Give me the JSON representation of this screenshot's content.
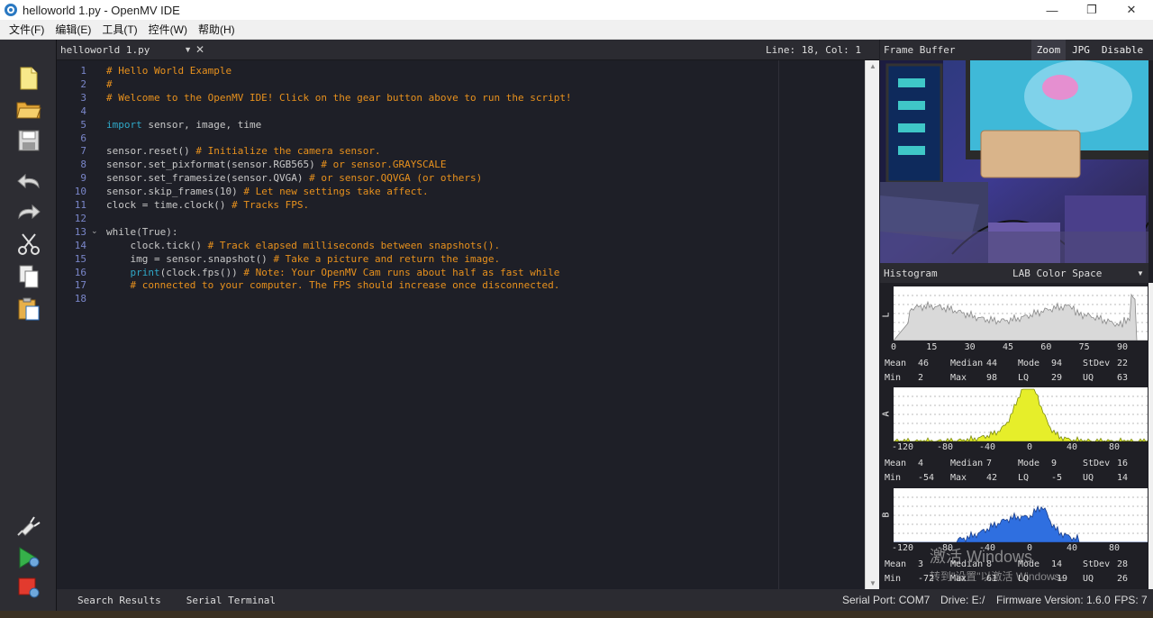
{
  "window": {
    "title": "helloworld 1.py - OpenMV IDE",
    "controls": {
      "minimize": "—",
      "restore": "❐",
      "close": "✕"
    }
  },
  "menu": [
    "文件(F)",
    "编辑(E)",
    "工具(T)",
    "控件(W)",
    "帮助(H)"
  ],
  "editor": {
    "tab_name": "helloworld 1.py",
    "cursor": "Line: 18, Col: 1",
    "lines": [
      {
        "n": "1",
        "text": "# Hello World Example"
      },
      {
        "n": "2",
        "text": "#"
      },
      {
        "n": "3",
        "text": "# Welcome to the OpenMV IDE! Click on the gear button above to run the script!"
      },
      {
        "n": "4",
        "text": ""
      },
      {
        "n": "5",
        "text": "import sensor, image, time"
      },
      {
        "n": "6",
        "text": ""
      },
      {
        "n": "7",
        "text": "sensor.reset() # Initialize the camera sensor."
      },
      {
        "n": "8",
        "text": "sensor.set_pixformat(sensor.RGB565) # or sensor.GRAYSCALE"
      },
      {
        "n": "9",
        "text": "sensor.set_framesize(sensor.QVGA) # or sensor.QQVGA (or others)"
      },
      {
        "n": "10",
        "text": "sensor.skip_frames(10) # Let new settings take affect."
      },
      {
        "n": "11",
        "text": "clock = time.clock() # Tracks FPS."
      },
      {
        "n": "12",
        "text": ""
      },
      {
        "n": "13",
        "text": "while(True):"
      },
      {
        "n": "14",
        "text": "    clock.tick() # Track elapsed milliseconds between snapshots()."
      },
      {
        "n": "15",
        "text": "    img = sensor.snapshot() # Take a picture and return the image."
      },
      {
        "n": "16",
        "text": "    print(clock.fps()) # Note: Your OpenMV Cam runs about half as fast while"
      },
      {
        "n": "17",
        "text": "    # connected to your computer. The FPS should increase once disconnected."
      },
      {
        "n": "18",
        "text": ""
      }
    ]
  },
  "frame_buffer": {
    "label": "Frame Buffer",
    "zoom": "Zoom",
    "jpg": "JPG",
    "disable": "Disable"
  },
  "histogram": {
    "label": "Histogram",
    "color_space": "LAB Color Space",
    "channels": [
      {
        "axis": "L",
        "ticks": [
          "0",
          "15",
          "30",
          "45",
          "60",
          "75",
          "90"
        ],
        "color": "#d9d9d9",
        "stats": {
          "mean_lbl": "Mean",
          "mean": "46",
          "median_lbl": "Median",
          "median": "44",
          "mode_lbl": "Mode",
          "mode": "94",
          "stdev_lbl": "StDev",
          "stdev": "22",
          "min_lbl": "Min",
          "min": "2",
          "max_lbl": "Max",
          "max": "98",
          "lq_lbl": "LQ",
          "lq": "29",
          "uq_lbl": "UQ",
          "uq": "63"
        }
      },
      {
        "axis": "A",
        "ticks": [
          "-120",
          "-80",
          "-40",
          "0",
          "40",
          "80"
        ],
        "color": "#e6ee2a",
        "stats": {
          "mean_lbl": "Mean",
          "mean": "4",
          "median_lbl": "Median",
          "median": "7",
          "mode_lbl": "Mode",
          "mode": "9",
          "stdev_lbl": "StDev",
          "stdev": "16",
          "min_lbl": "Min",
          "min": "-54",
          "max_lbl": "Max",
          "max": "42",
          "lq_lbl": "LQ",
          "lq": "-5",
          "uq_lbl": "UQ",
          "uq": "14"
        }
      },
      {
        "axis": "B",
        "ticks": [
          "-120",
          "-80",
          "-40",
          "0",
          "40",
          "80"
        ],
        "color": "#2f6fe0",
        "stats": {
          "mean_lbl": "Mean",
          "mean": "3",
          "median_lbl": "Median",
          "median": "8",
          "mode_lbl": "Mode",
          "mode": "14",
          "stdev_lbl": "StDev",
          "stdev": "28",
          "min_lbl": "Min",
          "min": "-72",
          "max_lbl": "Max",
          "max": "61",
          "lq_lbl": "LQ",
          "lq": "-19",
          "uq_lbl": "UQ",
          "uq": "26"
        }
      }
    ]
  },
  "bottom": {
    "search_results": "Search Results",
    "serial_terminal": "Serial Terminal",
    "serial_port": "Serial Port: COM7",
    "drive": "Drive: E:/",
    "firmware": "Firmware Version: 1.6.0",
    "fps": "FPS: 7"
  },
  "watermark": {
    "line1": "激活 Windows",
    "line2": "转到\"设置\"以激活 Windows。"
  },
  "icons": [
    "new-file-icon",
    "open-folder-icon",
    "save-icon",
    "undo-icon",
    "redo-icon",
    "cut-icon",
    "copy-icon",
    "paste-icon",
    "connect-icon",
    "run-icon",
    "stop-icon"
  ]
}
